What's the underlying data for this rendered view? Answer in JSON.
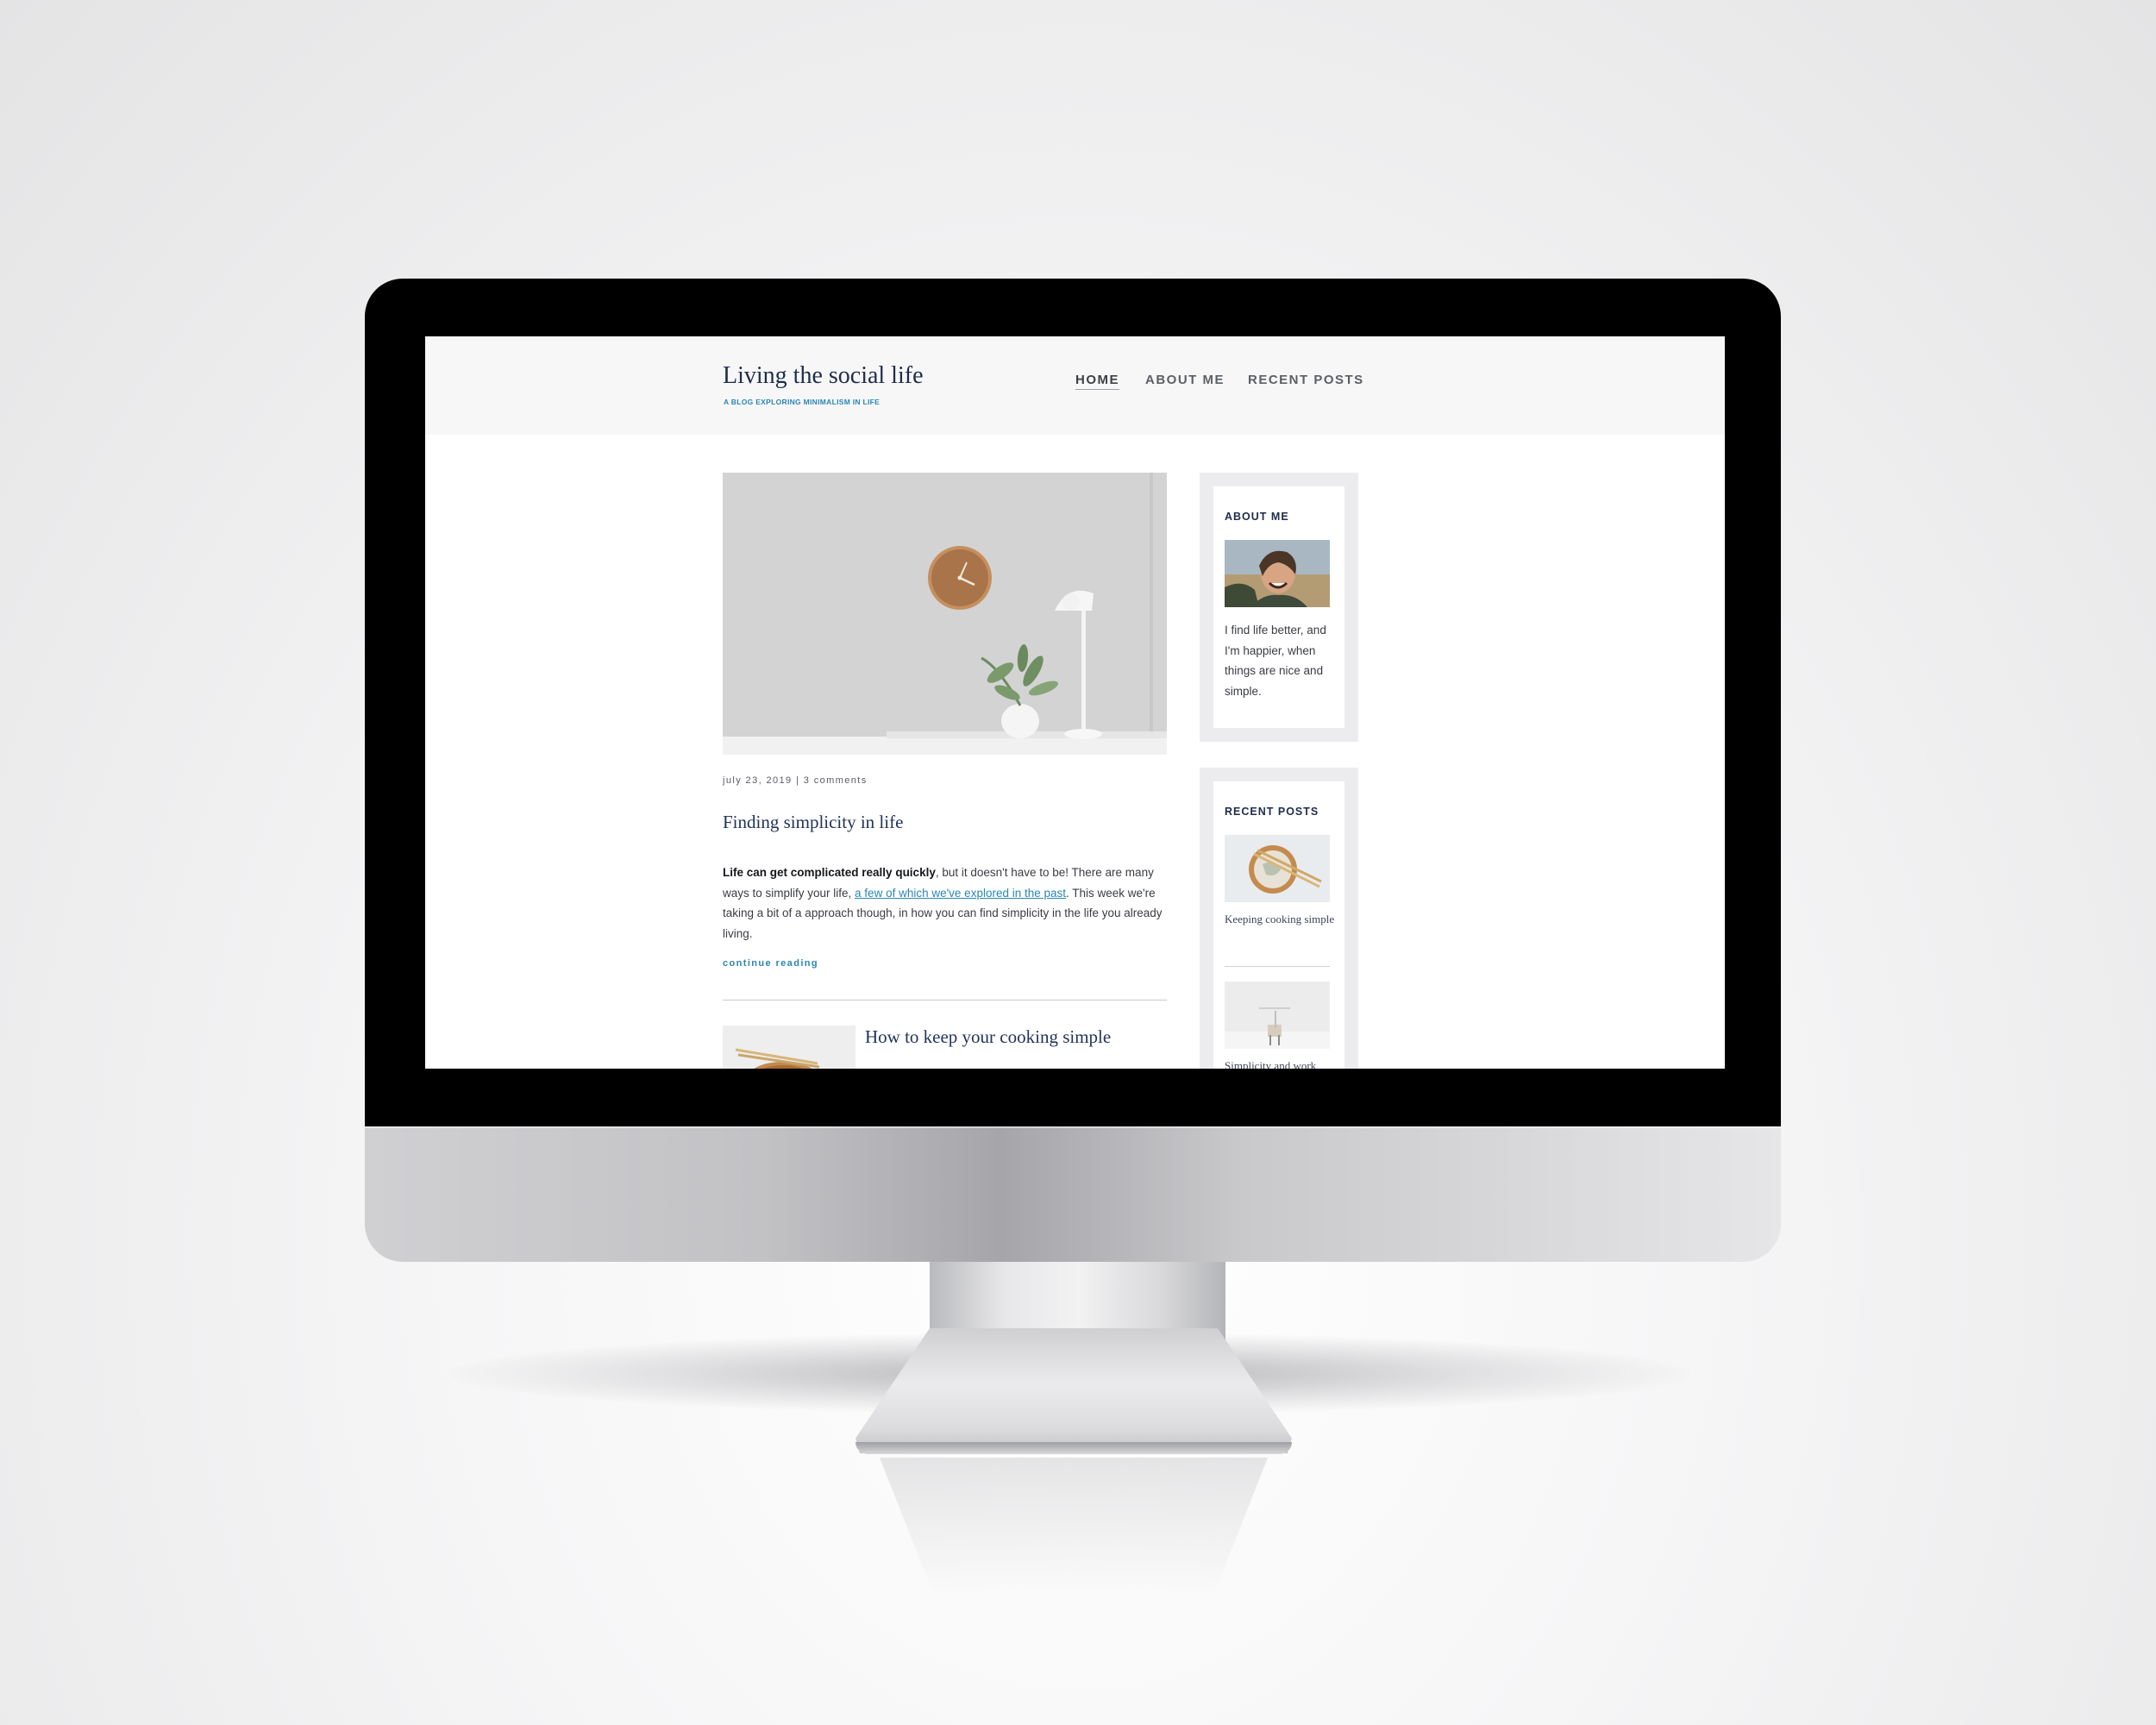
{
  "site": {
    "title": "Living the social life",
    "tagline": "A BLOG EXPLORING MINIMALISM IN LIFE"
  },
  "nav": {
    "home": "HOME",
    "about": "ABOUT ME",
    "recent": "RECENT POSTS",
    "active": "HOME"
  },
  "post": {
    "meta": "july 23, 2019 | 3 comments",
    "title": "Finding simplicity in life",
    "excerpt_bold": "Life can get complicated really quickly",
    "excerpt_1": ", but it doesn't have to be! There are many ways to simplify your life, ",
    "excerpt_link": "a few of which we've explored in the past",
    "excerpt_2": ". This week we're taking a bit of a approach though, in how you can find simplicity in the life you already living.",
    "continue": "continue reading"
  },
  "post2": {
    "title": "How to keep your cooking simple"
  },
  "sidebar": {
    "about": {
      "heading": "ABOUT ME",
      "text": "I find life better, and I'm happier, when things are nice and simple."
    },
    "recent": {
      "heading": "RECENT POSTS",
      "items": [
        {
          "label": "Keeping cooking simple"
        },
        {
          "label": "Simplicity and work"
        }
      ]
    }
  },
  "colors": {
    "accent": "#2b86b3",
    "heading": "#1f2d4a",
    "header_bg": "#f7f7f8"
  }
}
